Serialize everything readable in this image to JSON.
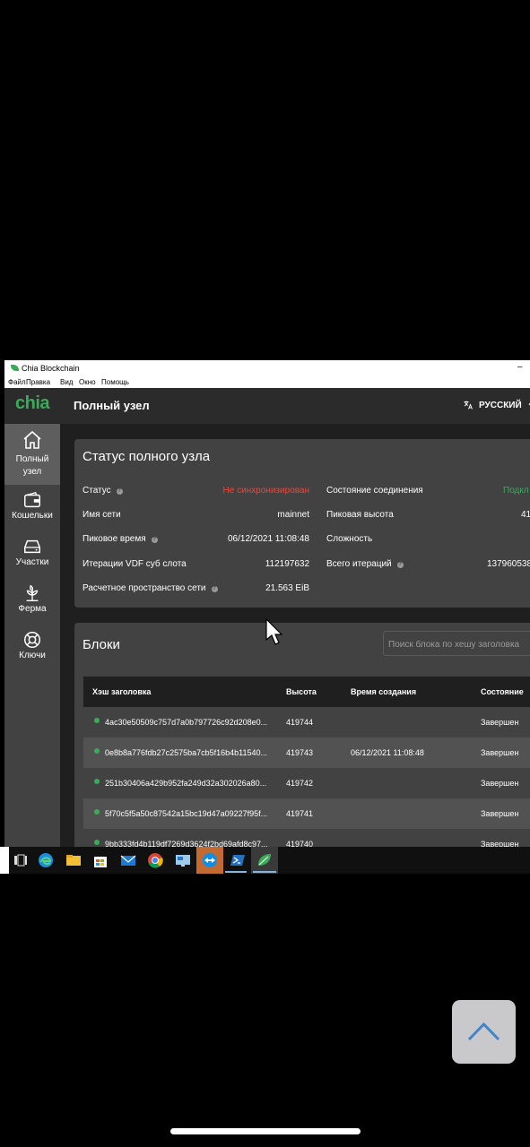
{
  "app": {
    "window_title": "Chia Blockchain",
    "logo_text": "chia",
    "minimize": "–"
  },
  "menu": [
    "Файл",
    "Правка",
    "Вид",
    "Окно",
    "Помощь"
  ],
  "sidebar": {
    "items": [
      {
        "label_line1": "Полный",
        "label_line2": "узел",
        "icon": "home-icon",
        "active": true
      },
      {
        "label": "Кошельки",
        "icon": "wallet-icon"
      },
      {
        "label": "Участки",
        "icon": "hard-drive-icon"
      },
      {
        "label": "Ферма",
        "icon": "sprout-icon"
      },
      {
        "label": "Ключи",
        "icon": "lifebuoy-icon"
      }
    ]
  },
  "header": {
    "title": "Полный узел",
    "language": "РУССКИЙ"
  },
  "status": {
    "title": "Статус полного узла",
    "left": [
      {
        "label": "Статус",
        "value": "Не синхронизирован"
      },
      {
        "label": "Имя сети",
        "value": "mainnet"
      },
      {
        "label": "Пиковое время",
        "value": "06/12/2021 11:08:48"
      },
      {
        "label": "Итерации VDF суб слота",
        "value": "112197632"
      },
      {
        "label": "Расчетное пространство сети",
        "value": "21.563 EiB"
      }
    ],
    "right": [
      {
        "label": "Состояние соединения",
        "value": "Подкл"
      },
      {
        "label": "Пиковая высота",
        "value": "41"
      },
      {
        "label": "Сложность",
        "value": ""
      },
      {
        "label": "Всего итераций",
        "value": "137960538"
      }
    ]
  },
  "blocks": {
    "title": "Блоки",
    "search_placeholder": "Поиск блока по хешу заголовка",
    "columns": [
      "Хэш заголовка",
      "Высота",
      "Время создания",
      "Состояние"
    ],
    "rows": [
      {
        "hash": "4ac30e50509c757d7a0b797726c92d208e0...",
        "height": "419744",
        "time": "",
        "state": "Завершен"
      },
      {
        "hash": "0e8b8a776fdb27c2575ba7cb5f16b4b11540...",
        "height": "419743",
        "time": "06/12/2021 11:08:48",
        "state": "Завершен"
      },
      {
        "hash": "251b30406a429b952fa249d32a302026a80...",
        "height": "419742",
        "time": "",
        "state": "Завершен"
      },
      {
        "hash": "5f70c5f5a50c87542a15bc19d47a09227f95f...",
        "height": "419741",
        "time": "",
        "state": "Завершен"
      },
      {
        "hash": "9bb333fd4b119df7269d3624f2bd69afd8c97...",
        "height": "419740",
        "time": "",
        "state": "Завершен"
      }
    ]
  },
  "colors": {
    "accent": "#3aac59",
    "error": "#f44336",
    "success": "#3aac59"
  }
}
